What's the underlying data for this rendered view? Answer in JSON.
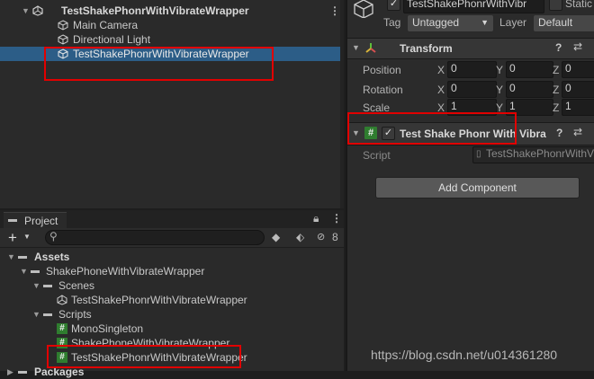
{
  "hierarchy": {
    "scene_name": "TestShakePhonrWithVibrateWrapper",
    "items": [
      {
        "label": "Main Camera"
      },
      {
        "label": "Directional Light"
      },
      {
        "label": "TestShakePhonrWithVibrateWrapper"
      }
    ],
    "more_icon": "⋮"
  },
  "inspector": {
    "object_name": "TestShakePhonrWithVibr",
    "static_label": "Static",
    "tag_label": "Tag",
    "tag_value": "Untagged",
    "layer_label": "Layer",
    "layer_value": "Default",
    "transform": {
      "title": "Transform",
      "rows": [
        {
          "label": "Position",
          "x": "0",
          "y": "0",
          "z": "0"
        },
        {
          "label": "Rotation",
          "x": "0",
          "y": "0",
          "z": "0"
        },
        {
          "label": "Scale",
          "x": "1",
          "y": "1",
          "z": "1"
        }
      ],
      "axis_x": "X",
      "axis_y": "Y",
      "axis_z": "Z"
    },
    "script_component": {
      "title": "Test Shake Phonr With Vibra",
      "script_label": "Script",
      "script_value": "TestShakePhonrWithVi"
    },
    "add_component_label": "Add Component"
  },
  "project": {
    "tab_label": "Project",
    "add_label": "+",
    "hidden_count": "8",
    "tree": [
      {
        "label": "Assets"
      },
      {
        "label": "ShakePhoneWithVibrateWrapper"
      },
      {
        "label": "Scenes"
      },
      {
        "label": "TestShakePhonrWithVibrateWrapper"
      },
      {
        "label": "Scripts"
      },
      {
        "label": "MonoSingleton"
      },
      {
        "label": "ShakePhoneWithVibrateWrapper"
      },
      {
        "label": "TestShakePhonrWithVibrateWrapper"
      },
      {
        "label": "Packages"
      }
    ]
  },
  "watermark": "https://blog.csdn.net/u014361280",
  "colors": {
    "selection": "#2c5d87",
    "highlight_box": "#e10000",
    "script_icon": "#3aa53a"
  }
}
